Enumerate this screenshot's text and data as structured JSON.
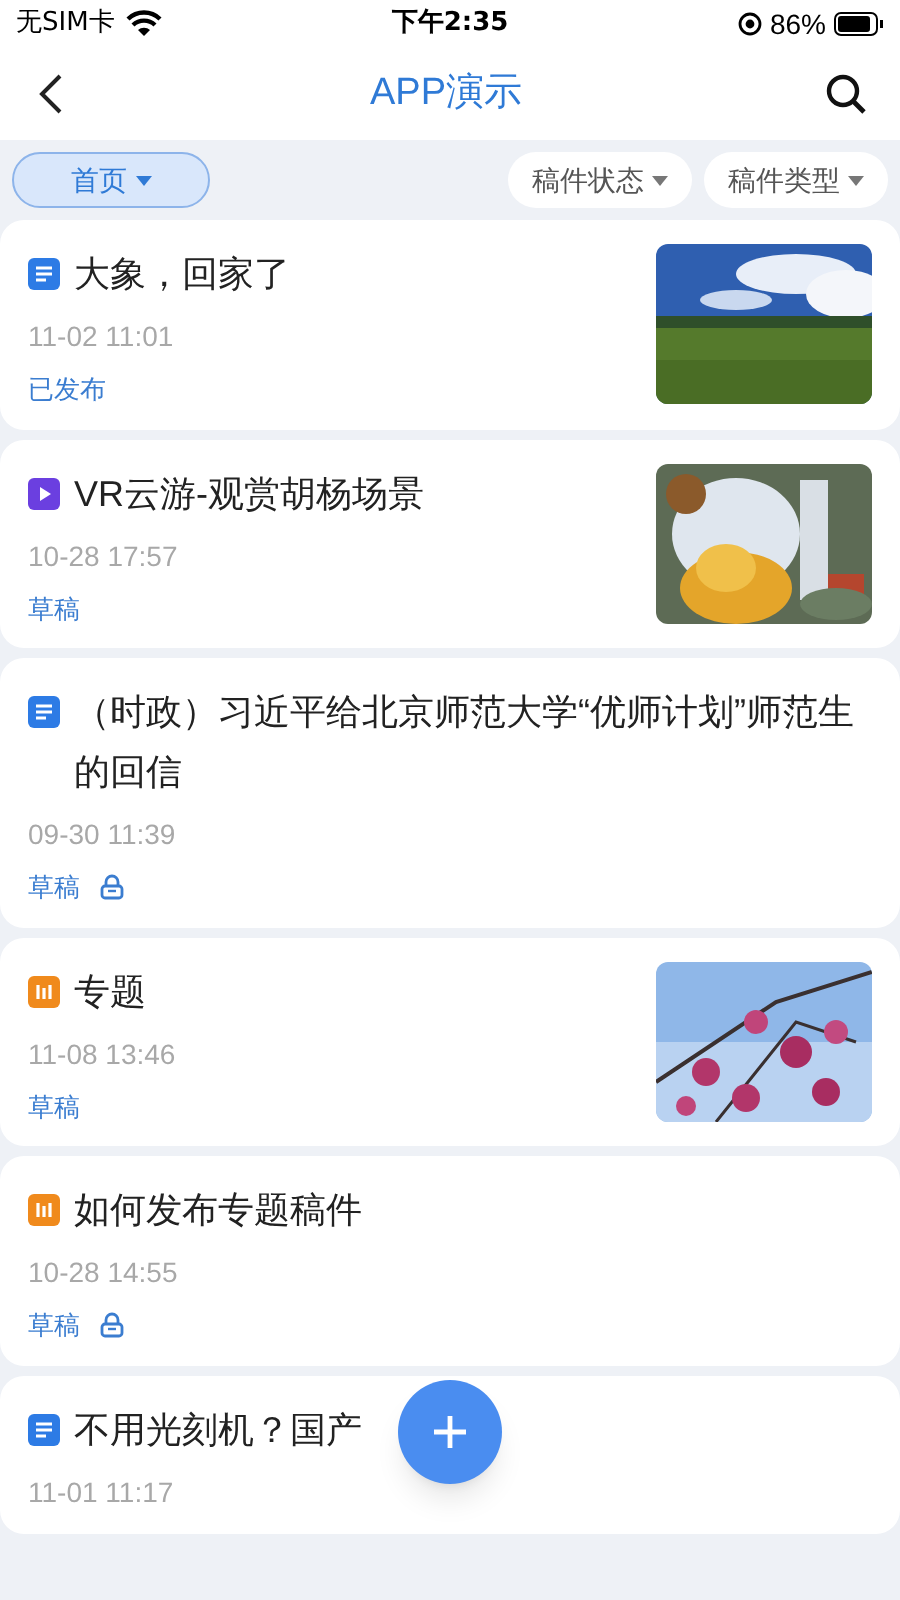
{
  "status_bar": {
    "carrier": "无SIM卡",
    "time": "下午2:35",
    "battery": "86%"
  },
  "nav": {
    "title": "APP演示"
  },
  "filters": [
    {
      "label": "首页",
      "selected": true
    },
    {
      "label": "稿件状态",
      "selected": false
    },
    {
      "label": "稿件类型",
      "selected": false
    }
  ],
  "items": [
    {
      "kind": "article",
      "title": "大象，回家了",
      "date": "11-02 11:01",
      "status": "已发布",
      "locked": false
    },
    {
      "kind": "video",
      "title": "VR云游-观赏胡杨场景",
      "date": "10-28 17:57",
      "status": "草稿",
      "locked": false
    },
    {
      "kind": "article",
      "title": "（时政）习近平给北京师范大学“优师计划”师范生的回信",
      "date": "09-30 11:39",
      "status": "草稿",
      "locked": true
    },
    {
      "kind": "topic",
      "title": "专题",
      "date": "11-08 13:46",
      "status": "草稿",
      "locked": false
    },
    {
      "kind": "topic",
      "title": "如何发布专题稿件",
      "date": "10-28 14:55",
      "status": "草稿",
      "locked": true
    },
    {
      "kind": "article",
      "title": "不用光刻机？国产",
      "date": "11-01 11:17"
    }
  ]
}
